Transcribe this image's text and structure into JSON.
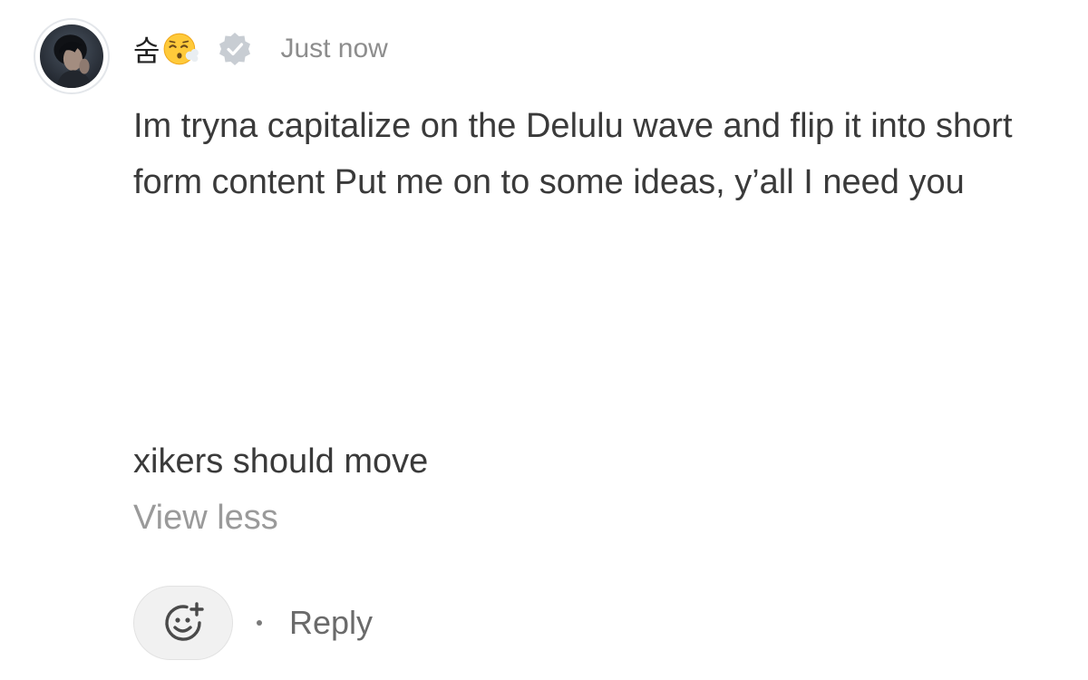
{
  "comment": {
    "author": {
      "name": "숨",
      "emoji": "face-exhaling",
      "verified": true,
      "avatar": "profile-photo"
    },
    "timestamp": "Just now",
    "text": "Im tryna capitalize on the Delulu wave and flip it into short form content Put me on to some ideas, y’all I need you",
    "text_continued": "xikers should move",
    "view_less_label": "View less",
    "actions": {
      "add_reaction_icon": "add-reaction-icon",
      "reply_label": "Reply"
    }
  },
  "colors": {
    "text": "#3a3a3a",
    "muted": "#9a9a9a",
    "verified_badge": "#c8cdd3",
    "reaction_button_bg": "#f1f1f1"
  }
}
